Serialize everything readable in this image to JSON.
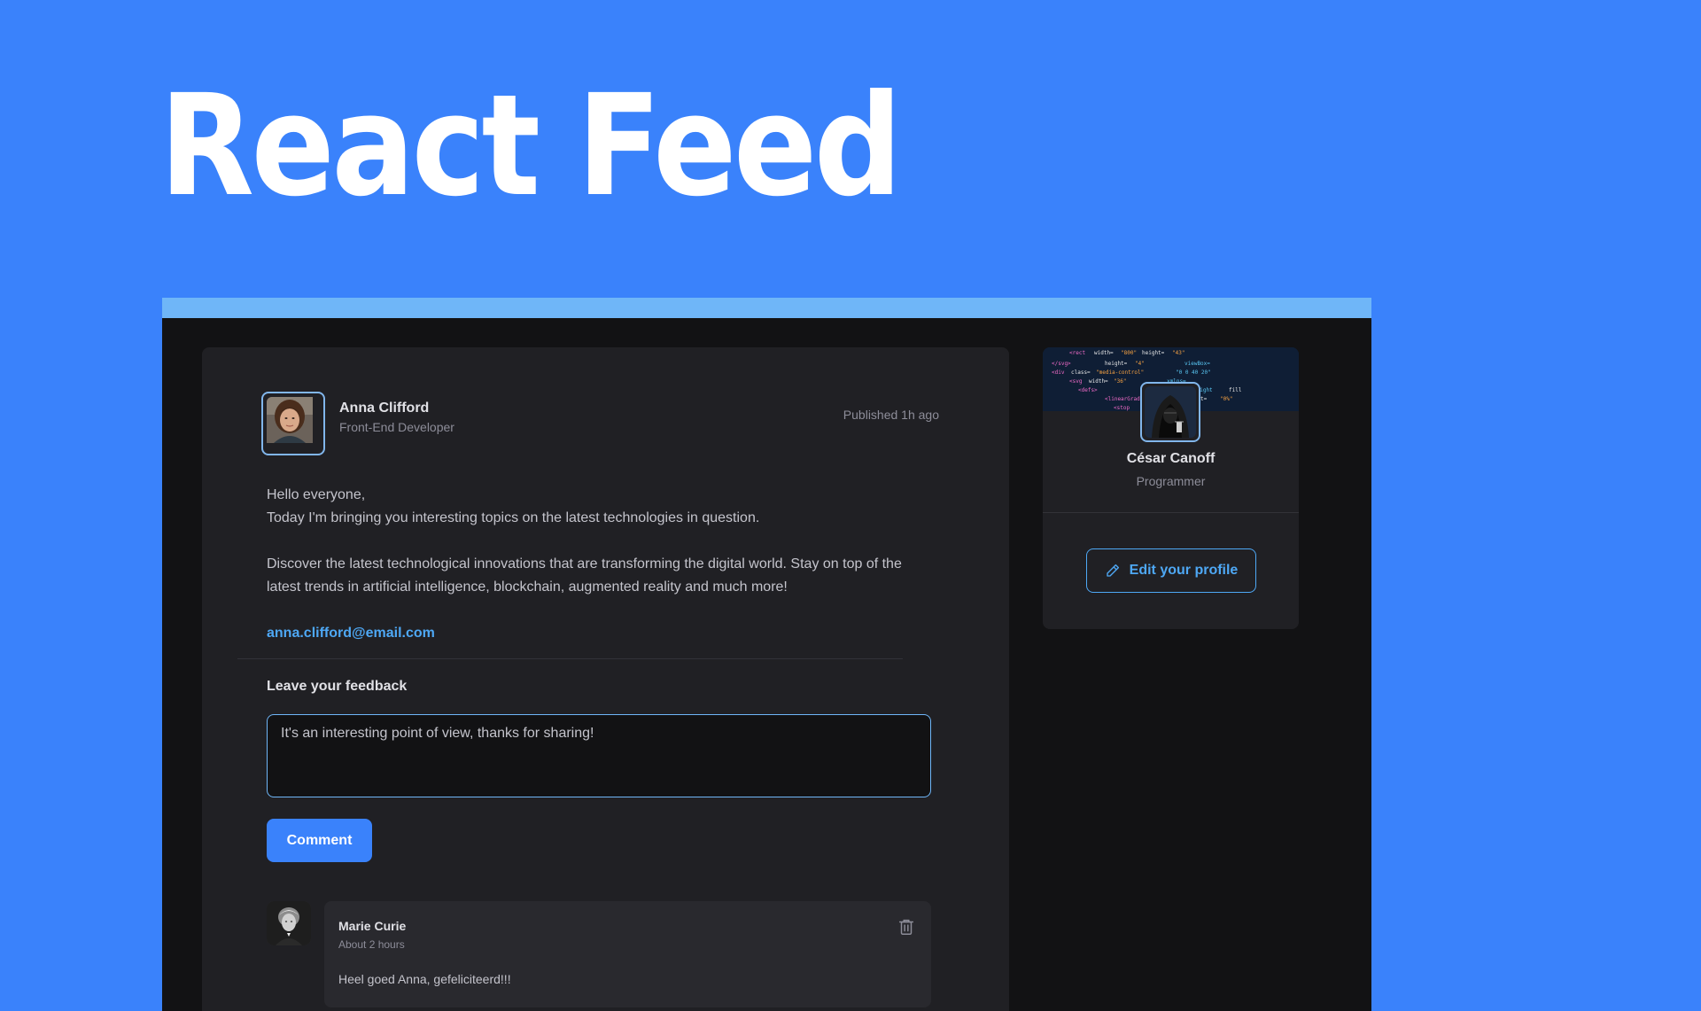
{
  "page": {
    "title": "React Feed"
  },
  "post": {
    "author": {
      "name": "Anna Clifford",
      "role": "Front-End Developer",
      "avatar": "avatar-anna"
    },
    "published": "Published 1h ago",
    "content": {
      "greeting": "Hello everyone,",
      "intro": "Today I'm bringing you interesting topics on the latest technologies in question.",
      "body": "Discover the latest technological innovations that are transforming the digital world. Stay on top of the latest trends in artificial intelligence, blockchain, augmented reality and much more!",
      "email": "anna.clifford@email.com"
    },
    "feedback": {
      "title": "Leave your feedback",
      "value": "It's an interesting point of view, thanks for sharing!",
      "button": "Comment"
    },
    "comments": [
      {
        "author": "Marie Curie",
        "time": "About 2 hours",
        "text": "Heel goed Anna, gefeliciteerd!!!",
        "avatar": "avatar-marie",
        "delete_icon": "trash-icon"
      }
    ]
  },
  "sidebar": {
    "profile": {
      "name": "César Canoff",
      "role": "Programmer",
      "avatar": "avatar-cesar"
    },
    "edit_button": "Edit your profile",
    "edit_icon": "pencil-icon"
  },
  "colors": {
    "background": "#3a82fb",
    "frame": "#121214",
    "card": "#202024",
    "accent": "#4ea8f5",
    "strip": "#6fb6f8",
    "button": "#3a82fb"
  }
}
